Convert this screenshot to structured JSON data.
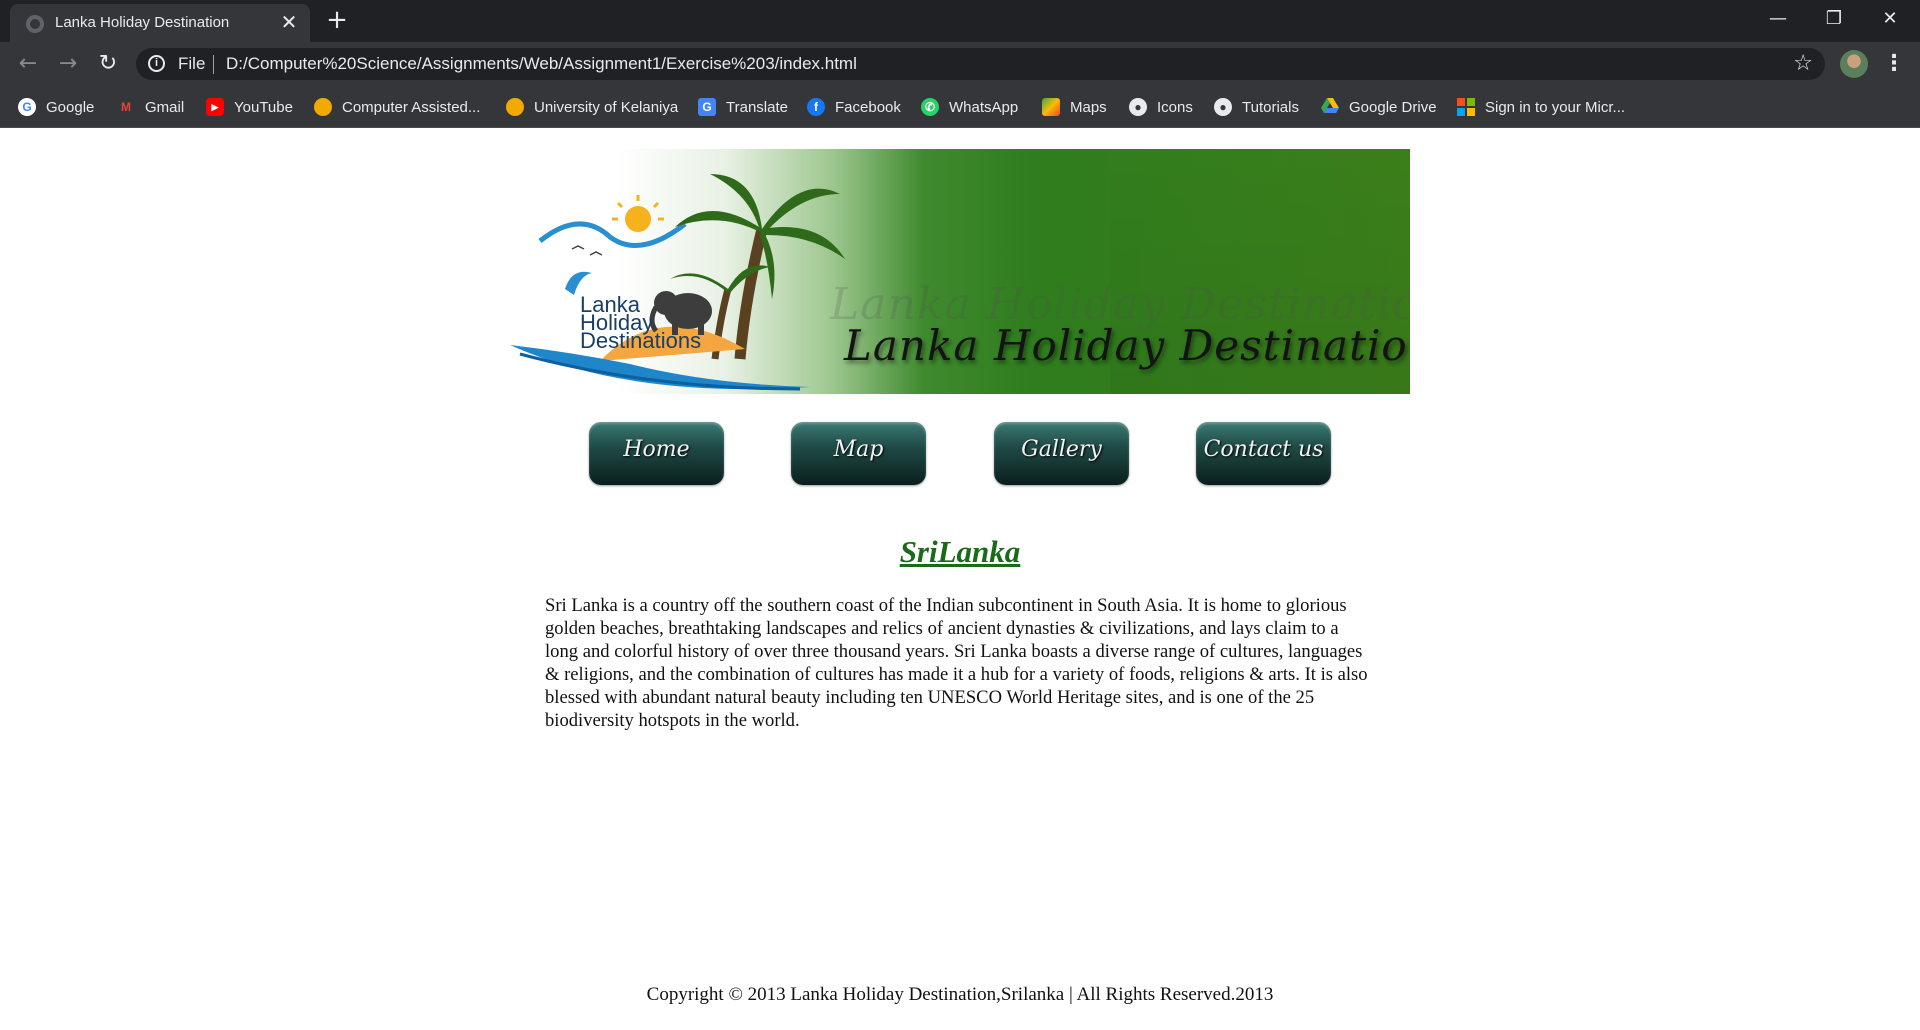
{
  "browser": {
    "tab_title": "Lanka Holiday Destination",
    "tab_close": "✕",
    "new_tab": "+",
    "scheme": "File",
    "url": "D:/Computer%20Science/Assignments/Web/Assignment1/Exercise%203/index.html",
    "window": {
      "minimize": "—",
      "restore": "❐",
      "close": "✕"
    },
    "bookmarks": [
      {
        "label": "Google",
        "icon": "google-icon",
        "color": "#ffffff"
      },
      {
        "label": "Gmail",
        "icon": "gmail-icon",
        "color": "#ea4335"
      },
      {
        "label": "YouTube",
        "icon": "youtube-icon",
        "color": "#ff0000"
      },
      {
        "label": "Computer Assisted...",
        "icon": "moodle-icon",
        "color": "#f2a900"
      },
      {
        "label": "University of Kelaniya",
        "icon": "university-icon",
        "color": "#f2a900"
      },
      {
        "label": "Translate",
        "icon": "translate-icon",
        "color": "#4285f4"
      },
      {
        "label": "Facebook",
        "icon": "facebook-icon",
        "color": "#1877f2"
      },
      {
        "label": "WhatsApp",
        "icon": "whatsapp-icon",
        "color": "#25d366"
      },
      {
        "label": "Maps",
        "icon": "maps-icon",
        "color": "#34a853"
      },
      {
        "label": "Icons",
        "icon": "globe-icon",
        "color": "#e8eaed"
      },
      {
        "label": "Tutorials",
        "icon": "globe-icon",
        "color": "#e8eaed"
      },
      {
        "label": "Google Drive",
        "icon": "drive-icon",
        "color": "#fbbc04"
      },
      {
        "label": "Sign in to your Micr...",
        "icon": "microsoft-icon",
        "color": "#f25022"
      }
    ]
  },
  "site": {
    "banner": {
      "logo_lines": [
        "Lanka",
        "Holiday",
        "Destinations"
      ],
      "title": "Lanka Holiday Destination",
      "title_ghost": "Lanka Holiday Destination"
    },
    "nav": [
      "Home",
      "Map",
      "Gallery",
      "Contact us"
    ],
    "heading": "SriLanka",
    "intro": "Sri Lanka is a country off the southern coast of the Indian subcontinent in South Asia. It is home to glorious golden beaches, breathtaking landscapes and relics of ancient dynasties & civilizations, and lays claim to a long and colorful history of over three thousand years. Sri Lanka boasts a diverse range of cultures, languages & religions, and the combination of cultures has made it a hub for a variety of foods, religions & arts. It is also blessed with abundant natural beauty including ten UNESCO World Heritage sites, and is one of the 25 biodiversity hotspots in the world.",
    "footer": "Copyright © 2013 Lanka Holiday Destination,Srilanka | All Rights Reserved.2013"
  },
  "colors": {
    "heading": "#196b17",
    "banner_green": "#2f7d1e",
    "nav_button": "#1f4a46"
  }
}
